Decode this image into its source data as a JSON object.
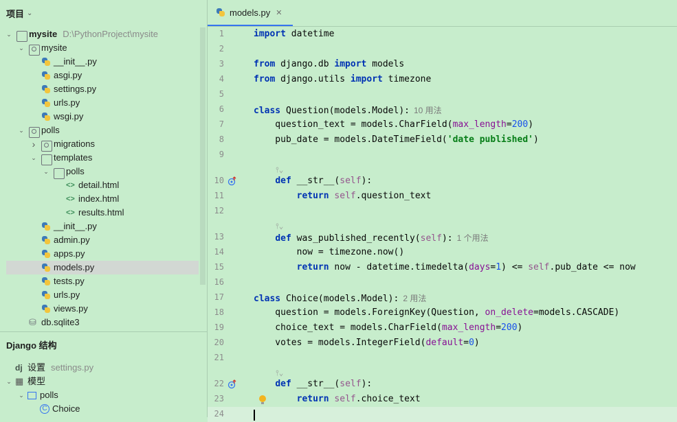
{
  "project_panel": {
    "title": "项目",
    "tree": [
      {
        "label": "mysite",
        "path": "D:\\PythonProject\\mysite",
        "type": "folder",
        "indent": 0,
        "arrow": "open",
        "bold": true
      },
      {
        "label": "mysite",
        "type": "module-folder",
        "indent": 1,
        "arrow": "open"
      },
      {
        "label": "__init__.py",
        "type": "py",
        "indent": 2
      },
      {
        "label": "asgi.py",
        "type": "py",
        "indent": 2
      },
      {
        "label": "settings.py",
        "type": "py",
        "indent": 2
      },
      {
        "label": "urls.py",
        "type": "py",
        "indent": 2
      },
      {
        "label": "wsgi.py",
        "type": "py",
        "indent": 2
      },
      {
        "label": "polls",
        "type": "module-folder",
        "indent": 1,
        "arrow": "open"
      },
      {
        "label": "migrations",
        "type": "module-folder",
        "indent": 2,
        "arrow": "closed"
      },
      {
        "label": "templates",
        "type": "folder",
        "indent": 2,
        "arrow": "open"
      },
      {
        "label": "polls",
        "type": "folder",
        "indent": 3,
        "arrow": "open"
      },
      {
        "label": "detail.html",
        "type": "html",
        "indent": 4
      },
      {
        "label": "index.html",
        "type": "html",
        "indent": 4
      },
      {
        "label": "results.html",
        "type": "html",
        "indent": 4
      },
      {
        "label": "__init__.py",
        "type": "py",
        "indent": 2
      },
      {
        "label": "admin.py",
        "type": "py",
        "indent": 2
      },
      {
        "label": "apps.py",
        "type": "py",
        "indent": 2
      },
      {
        "label": "models.py",
        "type": "py",
        "indent": 2,
        "selected": true
      },
      {
        "label": "tests.py",
        "type": "py",
        "indent": 2
      },
      {
        "label": "urls.py",
        "type": "py",
        "indent": 2
      },
      {
        "label": "views.py",
        "type": "py",
        "indent": 2
      },
      {
        "label": "db.sqlite3",
        "type": "db",
        "indent": 1
      }
    ]
  },
  "django_panel": {
    "title": "Django 结构",
    "items": [
      {
        "icon": "dj",
        "label": "设置",
        "extra": "settings.py",
        "indent": 0
      },
      {
        "icon": "table",
        "label": "模型",
        "indent": 0,
        "arrow": "open"
      },
      {
        "icon": "app",
        "label": "polls",
        "indent": 1,
        "arrow": "open"
      },
      {
        "icon": "class",
        "label": "Choice",
        "indent": 2
      }
    ]
  },
  "editor": {
    "tab_label": "models.py",
    "tab_close": "✕",
    "fold_hint_icon": "⫯⌄",
    "lines": [
      {
        "n": "1",
        "html": "<span class='kw'>import</span> datetime"
      },
      {
        "n": "2",
        "html": ""
      },
      {
        "n": "3",
        "html": "<span class='kw'>from</span> django.db <span class='kw'>import</span> models"
      },
      {
        "n": "4",
        "html": "<span class='kw'>from</span> django.utils <span class='kw'>import</span> timezone"
      },
      {
        "n": "5",
        "html": ""
      },
      {
        "n": "6",
        "html": "<span class='kw'>class</span> Question(models.Model):",
        "hint": "10 用法"
      },
      {
        "n": "7",
        "html": "    question_text = models.CharField(<span class='param'>max_length</span>=<span class='num'>200</span>)"
      },
      {
        "n": "8",
        "html": "    pub_date = models.DateTimeField(<span class='str'>'date published'</span>)"
      },
      {
        "n": "9",
        "html": ""
      },
      {
        "n": "10",
        "html": "    <span class='kw'>def</span> __str__(<span class='selfc'>self</span>):",
        "fold": true,
        "override": true
      },
      {
        "n": "11",
        "html": "        <span class='kw'>return</span> <span class='selfc'>self</span>.question_text"
      },
      {
        "n": "12",
        "html": ""
      },
      {
        "n": "13",
        "html": "    <span class='kw'>def</span> was_published_recently(<span class='selfc'>self</span>):",
        "hint": "1 个用法",
        "fold": true
      },
      {
        "n": "14",
        "html": "        now = timezone.now()"
      },
      {
        "n": "15",
        "html": "        <span class='kw'>return</span> now - datetime.timedelta(<span class='param'>days</span>=<span class='num'>1</span>) &lt;= <span class='selfc'>self</span>.pub_date &lt;= now"
      },
      {
        "n": "16",
        "html": ""
      },
      {
        "n": "17",
        "html": "<span class='kw'>class</span> Choice(models.Model):",
        "hint": "2 用法"
      },
      {
        "n": "18",
        "html": "    question = models.ForeignKey(Question, <span class='param'>on_delete</span>=models.CASCADE)"
      },
      {
        "n": "19",
        "html": "    choice_text = models.CharField(<span class='param'>max_length</span>=<span class='num'>200</span>)"
      },
      {
        "n": "20",
        "html": "    votes = models.IntegerField(<span class='param'>default</span>=<span class='num'>0</span>)"
      },
      {
        "n": "21",
        "html": ""
      },
      {
        "n": "22",
        "html": "    <span class='kw'>def</span> __str__(<span class='selfc'>self</span>):",
        "fold": true,
        "override": true
      },
      {
        "n": "23",
        "html": "        <span class='kw'>return</span> <span class='selfc'>self</span>.choice_text",
        "bulb": true
      },
      {
        "n": "24",
        "html": "",
        "caret": true
      }
    ]
  },
  "colors": {
    "background": "#c7edcc",
    "keyword": "#0033b3",
    "string": "#067d17",
    "number": "#1750eb",
    "selection": "#d2d8d3"
  }
}
